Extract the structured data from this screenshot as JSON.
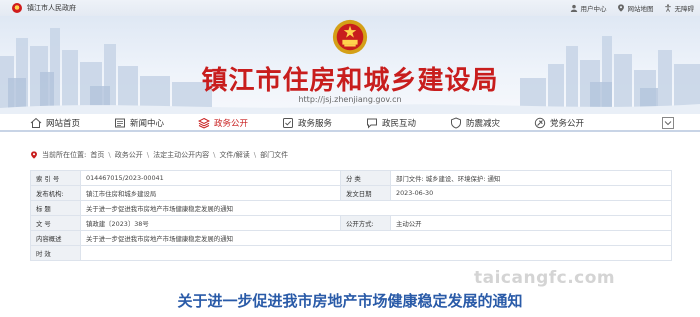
{
  "topbar": {
    "site_name": "镇江市人民政府",
    "links": [
      {
        "label": "用户中心",
        "icon": "user-icon"
      },
      {
        "label": "网站地图",
        "icon": "map-pin-icon"
      },
      {
        "label": "无障碍",
        "icon": "accessibility-icon"
      }
    ]
  },
  "banner": {
    "title": "镇江市住房和城乡建设局",
    "url": "http://jsj.zhenjiang.gov.cn"
  },
  "nav": {
    "items": [
      {
        "label": "网站首页",
        "icon": "home-icon"
      },
      {
        "label": "新闻中心",
        "icon": "news-icon"
      },
      {
        "label": "政务公开",
        "icon": "layers-icon"
      },
      {
        "label": "政务服务",
        "icon": "service-icon"
      },
      {
        "label": "政民互动",
        "icon": "chat-icon"
      },
      {
        "label": "防震减灾",
        "icon": "shield-icon"
      },
      {
        "label": "党务公开",
        "icon": "party-icon"
      }
    ],
    "active_index": 2
  },
  "breadcrumb": {
    "prefix": "当前所在位置:",
    "items": [
      "首页",
      "政务公开",
      "法定主动公开内容",
      "文件/解读",
      "部门文件"
    ]
  },
  "info": {
    "index_label": "索 引 号",
    "index_value": "014467015/2023-00041",
    "category_label": "分 类",
    "category_value": "部门文件: 城乡建设、环境保护: 通知",
    "org_label": "发布机构:",
    "org_value": "镇江市住房和城乡建设局",
    "date_label": "发文日期",
    "date_value": "2023-06-30",
    "title_label": "标 题",
    "title_value": "关于进一步促进我市房地产市场健康稳定发展的通知",
    "docno_label": "文 号",
    "docno_value": "镇政建〔2023〕38号",
    "mode_label": "公开方式:",
    "mode_value": "主动公开",
    "summary_label": "内容概述",
    "summary_value": "关于进一步促进我市房地产市场健康稳定发展的通知",
    "validity_label": "时 效",
    "validity_value": ""
  },
  "article": {
    "title": "关于进一步促进我市房地产市场健康稳定发展的通知"
  },
  "watermark": "taicangfc.com",
  "colors": {
    "brand_red": "#c81d1d",
    "title_blue": "#2a5ba8",
    "key_bg": "#eef1f5"
  }
}
